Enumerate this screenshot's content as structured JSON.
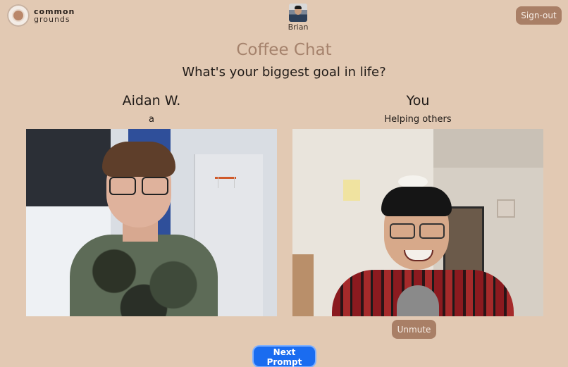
{
  "brand": {
    "line1": "common",
    "line2": "grounds"
  },
  "user": {
    "name": "Brian"
  },
  "header": {
    "signout_label": "Sign-out"
  },
  "main": {
    "title": "Coffee Chat",
    "prompt": "What's your biggest goal in life?"
  },
  "participants": [
    {
      "name": "Aidan W.",
      "answer": "a"
    },
    {
      "name": "You",
      "answer": "Helping others"
    }
  ],
  "controls": {
    "unmute_label": "Unmute",
    "next_prompt_label": "Next Prompt"
  },
  "colors": {
    "background": "#e2c9b3",
    "accent": "#a97f66",
    "title": "#a5826c",
    "primary": "#1a6cf0"
  }
}
